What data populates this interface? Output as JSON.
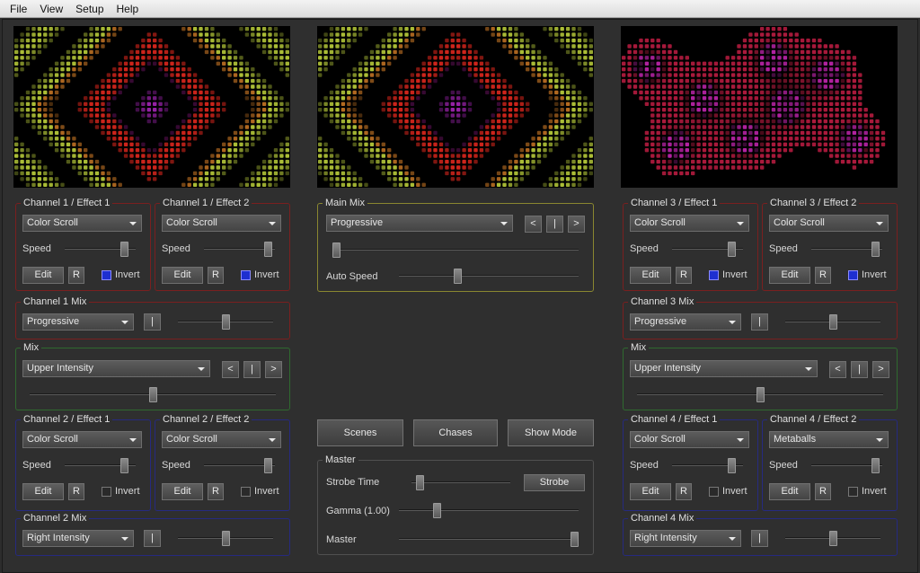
{
  "menu": [
    "File",
    "View",
    "Setup",
    "Help"
  ],
  "common": {
    "speed": "Speed",
    "edit": "Edit",
    "r": "R",
    "invert": "Invert",
    "prev": "<",
    "bar": "|",
    "next": ">"
  },
  "ch1e1": {
    "title": "Channel 1 / Effect 1",
    "effect": "Color Scroll",
    "speed": 0.88,
    "invert": true
  },
  "ch1e2": {
    "title": "Channel 1 / Effect 2",
    "effect": "Color Scroll",
    "speed": 0.95,
    "invert": true
  },
  "ch1mix": {
    "title": "Channel 1 Mix",
    "mode": "Progressive",
    "level": 0.5
  },
  "mixL": {
    "title": "Mix",
    "mode": "Upper Intensity",
    "level": 0.5
  },
  "ch2e1": {
    "title": "Channel 2 / Effect 1",
    "effect": "Color Scroll",
    "speed": 0.88,
    "invert": false
  },
  "ch2e2": {
    "title": "Channel 2 / Effect 2",
    "effect": "Color Scroll",
    "speed": 0.95,
    "invert": false
  },
  "ch2mix": {
    "title": "Channel 2 Mix",
    "mode": "Right Intensity",
    "level": 0.5
  },
  "mainmix": {
    "title": "Main Mix",
    "mode": "Progressive",
    "level": 0.0,
    "auto_speed_label": "Auto Speed",
    "auto_speed": 0.32
  },
  "buttons": {
    "scenes": "Scenes",
    "chases": "Chases",
    "showmode": "Show Mode"
  },
  "master": {
    "title": "Master",
    "strobe_time_label": "Strobe Time",
    "strobe_time": 0.05,
    "strobe_btn": "Strobe",
    "gamma_label": "Gamma (1.00)",
    "gamma": 0.2,
    "master_label": "Master",
    "master": 1.0
  },
  "ch3e1": {
    "title": "Channel 3 / Effect 1",
    "effect": "Color Scroll",
    "speed": 0.88,
    "invert": true
  },
  "ch3e2": {
    "title": "Channel 3 / Effect 2",
    "effect": "Color Scroll",
    "speed": 0.95,
    "invert": true
  },
  "ch3mix": {
    "title": "Channel 3 Mix",
    "mode": "Progressive",
    "level": 0.5
  },
  "mixR": {
    "title": "Mix",
    "mode": "Upper Intensity",
    "level": 0.5
  },
  "ch4e1": {
    "title": "Channel 4 / Effect 1",
    "effect": "Color Scroll",
    "speed": 0.88,
    "invert": false
  },
  "ch4e2": {
    "title": "Channel 4 / Effect 2",
    "effect": "Metaballs",
    "speed": 0.95,
    "invert": false
  },
  "ch4mix": {
    "title": "Channel 4 Mix",
    "mode": "Right Intensity",
    "level": 0.5
  },
  "colors": {
    "red_group": "#7a1f1f",
    "green_group": "#2f6a2f",
    "blue_group": "#262a80",
    "yellow_group": "#8a8730",
    "invert_on": "#1e2fd0"
  }
}
